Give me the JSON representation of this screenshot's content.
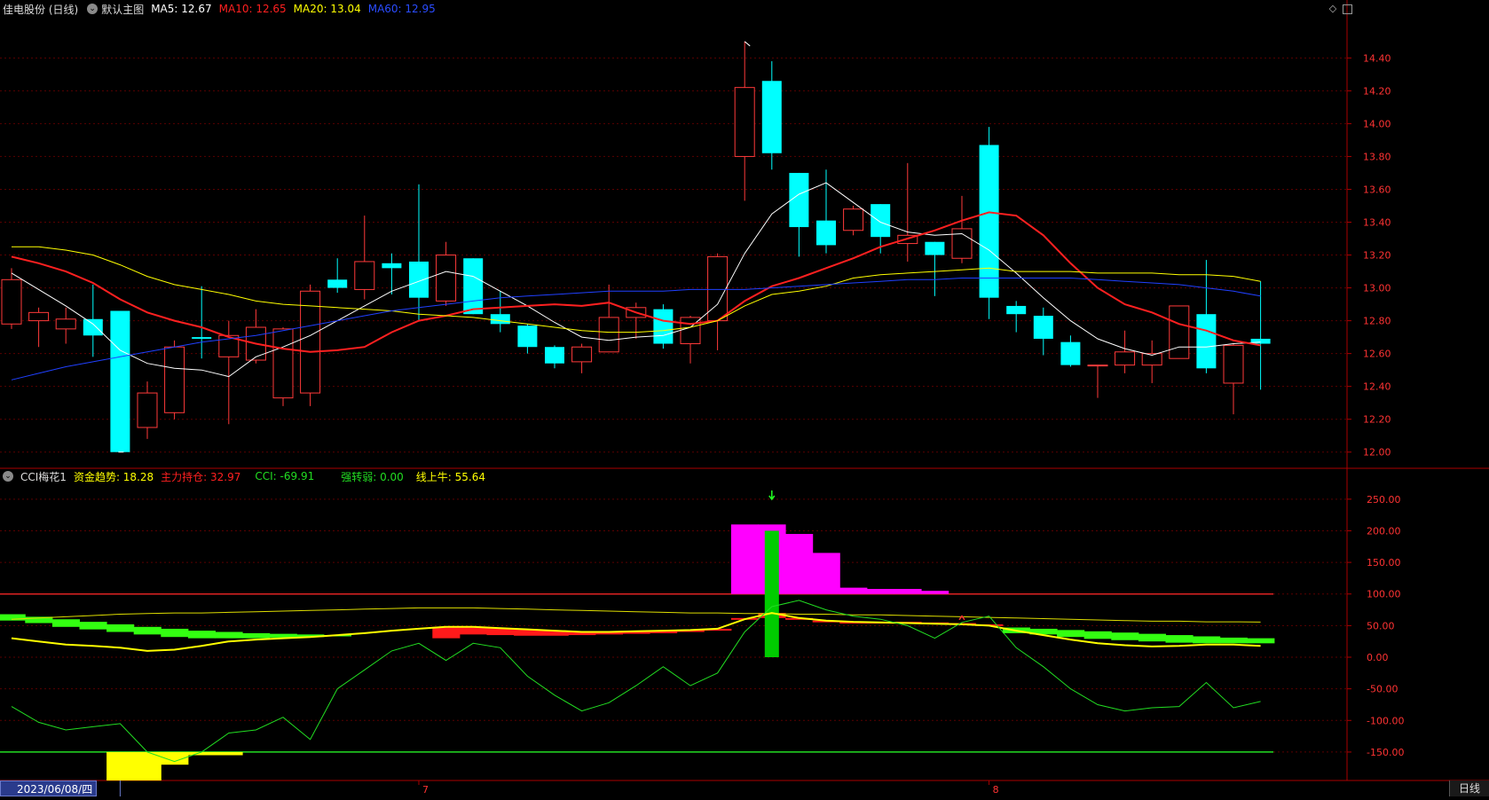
{
  "main_panel": {
    "stock_name": "佳电股份 (日线)",
    "indicator_name": "默认主图",
    "ma": [
      {
        "label": "MA5: 12.67",
        "color": "#ffffff"
      },
      {
        "label": "MA10: 12.65",
        "color": "#ff2020"
      },
      {
        "label": "MA20: 13.04",
        "color": "#ffff00"
      },
      {
        "label": "MA60: 12.95",
        "color": "#2040ff"
      }
    ],
    "high_label": "14.50",
    "low_label": "12.00",
    "marker_s": "S"
  },
  "sub_panel": {
    "indicator_name": "CCI梅花1",
    "items": [
      {
        "label": "资金趋势: 18.28",
        "color": "#ffff00"
      },
      {
        "label": "主力持仓: 32.97",
        "color": "#ff2020"
      },
      {
        "label": "CCI: -69.91",
        "color": "#22dd22"
      },
      {
        "label": "强转弱: 0.00",
        "color": "#22dd22"
      },
      {
        "label": "线上牛: 55.64",
        "color": "#ffff00"
      }
    ]
  },
  "bottom_bar": {
    "date": "2023/06/08/四",
    "month_labels": [
      "7",
      "8"
    ],
    "period": "日线"
  },
  "chart_data": [
    {
      "type": "candlestick",
      "title": "佳电股份 (日线)",
      "ylim": [
        11.95,
        14.58
      ],
      "y_ticks": [
        "14.40",
        "14.20",
        "14.00",
        "13.80",
        "13.60",
        "13.40",
        "13.20",
        "13.00",
        "12.80",
        "12.60",
        "12.40",
        "12.20",
        "12.00"
      ],
      "candles": [
        [
          12.78,
          13.05,
          13.12,
          12.75
        ],
        [
          12.8,
          12.85,
          12.88,
          12.64
        ],
        [
          12.75,
          12.81,
          12.88,
          12.66
        ],
        [
          12.81,
          12.71,
          13.02,
          12.58
        ],
        [
          12.86,
          12.0,
          12.86,
          12.0
        ],
        [
          12.15,
          12.36,
          12.43,
          12.08
        ],
        [
          12.24,
          12.64,
          12.68,
          12.2
        ],
        [
          12.7,
          12.69,
          13.01,
          12.57
        ],
        [
          12.58,
          12.71,
          12.8,
          12.17
        ],
        [
          12.56,
          12.76,
          12.87,
          12.54
        ],
        [
          12.33,
          12.75,
          12.76,
          12.28
        ],
        [
          12.36,
          12.98,
          13.02,
          12.28
        ],
        [
          13.05,
          13.0,
          13.18,
          12.97
        ],
        [
          12.99,
          13.16,
          13.44,
          12.93
        ],
        [
          13.15,
          13.12,
          13.21,
          12.96
        ],
        [
          13.16,
          12.94,
          13.63,
          12.8
        ],
        [
          12.92,
          13.2,
          13.28,
          12.89
        ],
        [
          13.18,
          12.84,
          13.18,
          12.84
        ],
        [
          12.84,
          12.78,
          12.98,
          12.73
        ],
        [
          12.77,
          12.64,
          12.78,
          12.6
        ],
        [
          12.64,
          12.54,
          12.65,
          12.51
        ],
        [
          12.55,
          12.64,
          12.66,
          12.48
        ],
        [
          12.61,
          12.82,
          13.02,
          12.61
        ],
        [
          12.82,
          12.88,
          12.91,
          12.69
        ],
        [
          12.87,
          12.66,
          12.9,
          12.63
        ],
        [
          12.66,
          12.82,
          12.83,
          12.54
        ],
        [
          12.8,
          13.19,
          13.21,
          12.62
        ],
        [
          13.8,
          14.22,
          14.5,
          13.53
        ],
        [
          14.26,
          13.82,
          14.38,
          13.72
        ],
        [
          13.7,
          13.37,
          13.7,
          13.19
        ],
        [
          13.41,
          13.26,
          13.72,
          13.21
        ],
        [
          13.35,
          13.48,
          13.5,
          13.32
        ],
        [
          13.51,
          13.31,
          13.51,
          13.21
        ],
        [
          13.27,
          13.32,
          13.76,
          13.16
        ],
        [
          13.28,
          13.2,
          13.28,
          12.95
        ],
        [
          13.18,
          13.36,
          13.56,
          13.15
        ],
        [
          13.87,
          12.94,
          13.98,
          12.81
        ],
        [
          12.89,
          12.84,
          12.92,
          12.73
        ],
        [
          12.83,
          12.69,
          12.88,
          12.59
        ],
        [
          12.67,
          12.53,
          12.71,
          12.52
        ],
        [
          12.53,
          12.53,
          12.53,
          12.33
        ],
        [
          12.53,
          12.61,
          12.74,
          12.48
        ],
        [
          12.53,
          12.6,
          12.68,
          12.42
        ],
        [
          12.57,
          12.89,
          12.89,
          12.57
        ],
        [
          12.84,
          12.51,
          13.17,
          12.48
        ],
        [
          12.42,
          12.65,
          12.66,
          12.23
        ],
        [
          12.69,
          12.66,
          13.04,
          12.38
        ]
      ],
      "series": [
        {
          "name": "MA5",
          "color": "#ffffff",
          "values": [
            13.09,
            12.99,
            12.89,
            12.78,
            12.62,
            12.54,
            12.51,
            12.5,
            12.46,
            12.58,
            12.64,
            12.71,
            12.8,
            12.89,
            12.98,
            13.04,
            13.1,
            13.07,
            12.98,
            12.89,
            12.79,
            12.7,
            12.68,
            12.7,
            12.71,
            12.76,
            12.9,
            13.21,
            13.45,
            13.57,
            13.64,
            13.52,
            13.4,
            13.34,
            13.32,
            13.33,
            13.23,
            13.09,
            12.94,
            12.8,
            12.69,
            12.63,
            12.59,
            12.64,
            12.64,
            12.66,
            12.67
          ]
        },
        {
          "name": "MA10",
          "color": "#ff2020",
          "values": [
            13.19,
            13.15,
            13.1,
            13.03,
            12.93,
            12.85,
            12.8,
            12.76,
            12.7,
            12.66,
            12.63,
            12.61,
            12.62,
            12.64,
            12.73,
            12.8,
            12.83,
            12.87,
            12.88,
            12.89,
            12.9,
            12.89,
            12.91,
            12.85,
            12.8,
            12.78,
            12.8,
            12.92,
            13.01,
            13.06,
            13.12,
            13.18,
            13.25,
            13.3,
            13.35,
            13.41,
            13.46,
            13.44,
            13.32,
            13.15,
            13.0,
            12.9,
            12.85,
            12.78,
            12.74,
            12.68,
            12.65
          ]
        },
        {
          "name": "MA20",
          "color": "#ffff00",
          "values": [
            13.25,
            13.25,
            13.23,
            13.2,
            13.14,
            13.07,
            13.02,
            12.99,
            12.96,
            12.92,
            12.9,
            12.89,
            12.88,
            12.87,
            12.86,
            12.84,
            12.83,
            12.82,
            12.8,
            12.78,
            12.76,
            12.74,
            12.73,
            12.73,
            12.74,
            12.76,
            12.8,
            12.89,
            12.96,
            12.98,
            13.01,
            13.06,
            13.08,
            13.09,
            13.1,
            13.11,
            13.12,
            13.1,
            13.1,
            13.1,
            13.09,
            13.09,
            13.09,
            13.08,
            13.08,
            13.07,
            13.04
          ]
        },
        {
          "name": "MA60",
          "color": "#2040ff",
          "values": [
            12.44,
            12.48,
            12.52,
            12.55,
            12.58,
            12.61,
            12.64,
            12.67,
            12.69,
            12.71,
            12.74,
            12.77,
            12.8,
            12.83,
            12.86,
            12.88,
            12.9,
            12.92,
            12.94,
            12.95,
            12.96,
            12.97,
            12.98,
            12.98,
            12.98,
            12.99,
            12.99,
            12.99,
            13.0,
            13.01,
            13.02,
            13.03,
            13.04,
            13.05,
            13.05,
            13.06,
            13.06,
            13.06,
            13.06,
            13.06,
            13.05,
            13.04,
            13.03,
            13.02,
            13.0,
            12.98,
            12.95
          ]
        }
      ]
    },
    {
      "type": "bar",
      "title": "CCI梅花1",
      "ylim": [
        -195,
        275
      ],
      "y_ticks": [
        "250.00",
        "200.00",
        "150.00",
        "100.00",
        "50.00",
        "0.00",
        "-50.00",
        "-100.00",
        "-150.00"
      ],
      "reference_lines": [
        100,
        -150
      ],
      "series": [
        {
          "name": "CCI",
          "color": "#22dd22",
          "values": [
            -78,
            -103,
            -115,
            -110,
            -105,
            -150,
            -165,
            -150,
            -120,
            -115,
            -95,
            -130,
            -50,
            -20,
            10,
            22,
            -5,
            22,
            15,
            -30,
            -60,
            -85,
            -72,
            -45,
            -15,
            -45,
            -25,
            40,
            80,
            90,
            75,
            65,
            60,
            50,
            30,
            55,
            65,
            15,
            -15,
            -50,
            -75,
            -85,
            -80,
            -78,
            -40,
            -80,
            -70
          ]
        },
        {
          "name": "资金趋势",
          "color": "#ffff00",
          "values": [
            30,
            25,
            20,
            18,
            15,
            10,
            12,
            18,
            25,
            28,
            30,
            32,
            35,
            38,
            42,
            45,
            48,
            48,
            46,
            44,
            42,
            40,
            40,
            41,
            42,
            43,
            45,
            60,
            70,
            62,
            58,
            56,
            55,
            54,
            53,
            52,
            50,
            42,
            35,
            28,
            22,
            19,
            17,
            18,
            20,
            20,
            18
          ]
        },
        {
          "name": "线上牛",
          "color": "#ffff00",
          "values": [
            60,
            62,
            64,
            66,
            68,
            69,
            70,
            70,
            71,
            72,
            73,
            74,
            75,
            76,
            77,
            78,
            78,
            78,
            77,
            76,
            75,
            74,
            73,
            72,
            71,
            70,
            70,
            69,
            69,
            68,
            68,
            67,
            67,
            66,
            65,
            64,
            63,
            62,
            61,
            60,
            59,
            58,
            57,
            57,
            56,
            56,
            55.64
          ]
        },
        {
          "name": "主力持仓",
          "color": "#ff2020",
          "values": [
            0,
            0,
            0,
            0,
            0,
            0,
            0,
            0,
            0,
            0,
            0,
            0,
            0,
            0,
            0,
            0,
            30,
            36,
            35,
            34,
            34,
            35,
            36,
            37,
            38,
            40,
            42,
            62,
            62,
            60,
            58,
            56,
            56,
            56,
            55,
            54,
            52,
            0,
            0,
            0,
            0,
            0,
            0,
            0,
            0,
            0,
            0
          ]
        },
        {
          "name": "green_band_top",
          "color": "#33ff11",
          "values": [
            68,
            64,
            60,
            56,
            52,
            48,
            45,
            42,
            40,
            38,
            37,
            36,
            35,
            0,
            0,
            0,
            0,
            0,
            0,
            0,
            0,
            0,
            0,
            0,
            0,
            0,
            0,
            0,
            0,
            0,
            0,
            0,
            0,
            0,
            0,
            0,
            0,
            47,
            45,
            43,
            41,
            39,
            37,
            35,
            33,
            31,
            30
          ]
        },
        {
          "name": "green_band_bottom",
          "color": "#33ff11",
          "values": [
            58,
            54,
            48,
            44,
            40,
            36,
            32,
            30,
            30,
            30,
            31,
            32,
            33,
            0,
            0,
            0,
            0,
            0,
            0,
            0,
            0,
            0,
            0,
            0,
            0,
            0,
            0,
            0,
            0,
            0,
            0,
            0,
            0,
            0,
            0,
            0,
            0,
            38,
            36,
            32,
            29,
            27,
            25,
            23,
            22,
            22,
            22
          ]
        },
        {
          "name": "magenta_bars",
          "color": "#ff00ff",
          "values": [
            0,
            0,
            0,
            0,
            0,
            0,
            0,
            0,
            0,
            0,
            0,
            0,
            0,
            0,
            0,
            0,
            0,
            0,
            0,
            0,
            0,
            0,
            0,
            0,
            0,
            0,
            0,
            210,
            210,
            195,
            165,
            110,
            108,
            108,
            105,
            0,
            0,
            0,
            0,
            0,
            0,
            0,
            0,
            0,
            0,
            0,
            0
          ]
        },
        {
          "name": "yellow_bars",
          "color": "#ffff00",
          "values": [
            0,
            0,
            0,
            0,
            -195,
            -195,
            -170,
            -155,
            -155,
            0,
            0,
            0,
            0,
            0,
            0,
            0,
            0,
            0,
            0,
            0,
            0,
            0,
            0,
            0,
            0,
            0,
            0,
            0,
            0,
            0,
            0,
            0,
            0,
            0,
            0,
            0,
            0,
            0,
            0,
            0,
            0,
            0,
            0,
            0,
            0,
            0,
            0
          ]
        },
        {
          "name": "green_bar",
          "color": "#00cc00",
          "values": [
            0,
            0,
            0,
            0,
            0,
            0,
            0,
            0,
            0,
            0,
            0,
            0,
            0,
            0,
            0,
            0,
            0,
            0,
            0,
            0,
            0,
            0,
            0,
            0,
            0,
            0,
            0,
            0,
            200,
            0,
            0,
            0,
            0,
            0,
            0,
            0,
            0,
            0,
            0,
            0,
            0,
            0,
            0,
            0,
            0,
            0,
            0
          ]
        }
      ]
    }
  ]
}
